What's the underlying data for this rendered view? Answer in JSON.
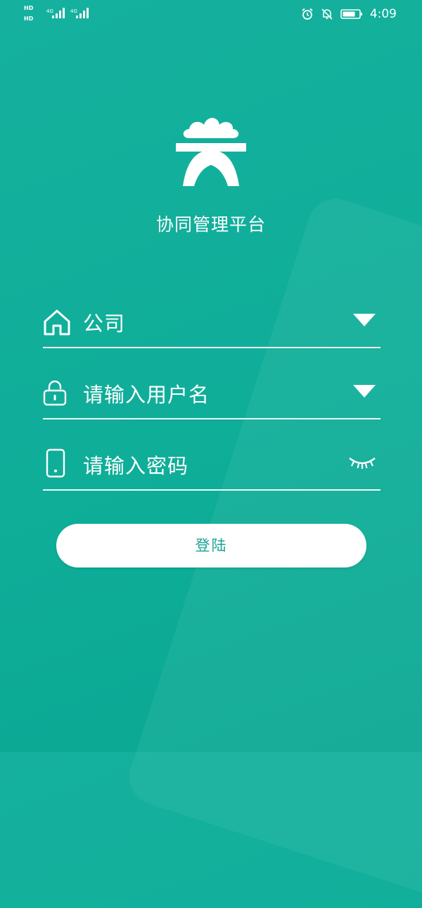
{
  "status_bar": {
    "sim1": "HD",
    "sim2": "HD",
    "net1": "4G",
    "net2": "4G",
    "time": "4:09"
  },
  "app": {
    "title": "协同管理平台"
  },
  "form": {
    "company": {
      "label": "公司",
      "icon": "home-icon",
      "action_icon": "dropdown-triangle-icon"
    },
    "username": {
      "placeholder": "请输入用户名",
      "icon": "lock-icon",
      "action_icon": "dropdown-triangle-icon"
    },
    "password": {
      "placeholder": "请输入密码",
      "icon": "phone-icon",
      "action_icon": "eye-closed-icon"
    },
    "login_label": "登陆"
  },
  "colors": {
    "background": "#12ae9a",
    "foreground": "#ffffff",
    "button_text": "#1aa492"
  }
}
